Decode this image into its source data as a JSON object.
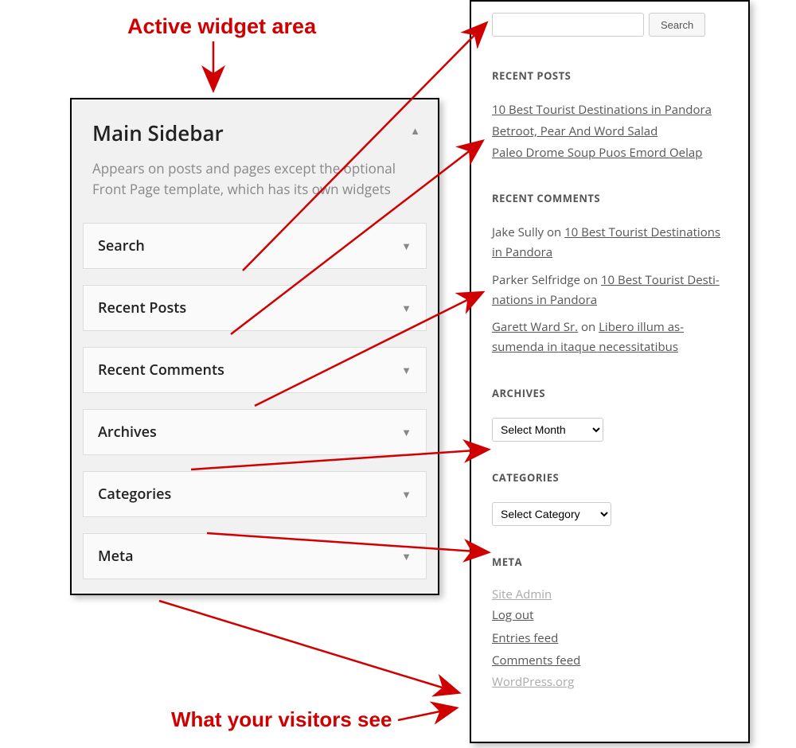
{
  "annotations": {
    "top": "Active widget area",
    "bottom": "What your visitors see"
  },
  "admin": {
    "title": "Main Sidebar",
    "description": "Appears on posts and pages except the optional Front Page template, which has its own widgets",
    "widgets": [
      "Search",
      "Recent Posts",
      "Recent Comments",
      "Archives",
      "Categories",
      "Meta"
    ]
  },
  "frontend": {
    "search_button": "Search",
    "recent_posts": {
      "heading": "RECENT POSTS",
      "items": [
        "10 Best Tourist Destinations in Pandora",
        "Betroot, Pear And Word Salad",
        "Paleo Drome Soup Puos Emord Oelap"
      ]
    },
    "recent_comments": {
      "heading": "RECENT COMMENTS",
      "on": " on ",
      "items": [
        {
          "author": "Jake Sully",
          "author_link": false,
          "post": "10 Best Tourist Destinations in Pandora"
        },
        {
          "author": "Parker Selfridge",
          "author_link": false,
          "post": "10 Best Tourist Desti­nations in Pandora"
        },
        {
          "author": "Garett Ward Sr.",
          "author_link": true,
          "post": "Libero illum as­sumenda in itaque necessitatibus"
        }
      ]
    },
    "archives": {
      "heading": "ARCHIVES",
      "select": "Select Month"
    },
    "categories": {
      "heading": "CATEGORIES",
      "select": "Select Category"
    },
    "meta": {
      "heading": "META",
      "items": [
        {
          "label": "Site Admin",
          "gray": true
        },
        {
          "label": "Log out",
          "gray": false
        },
        {
          "label": "Entries feed",
          "gray": false
        },
        {
          "label": "Comments feed",
          "gray": false
        },
        {
          "label": "WordPress.org",
          "gray": true
        }
      ]
    }
  }
}
